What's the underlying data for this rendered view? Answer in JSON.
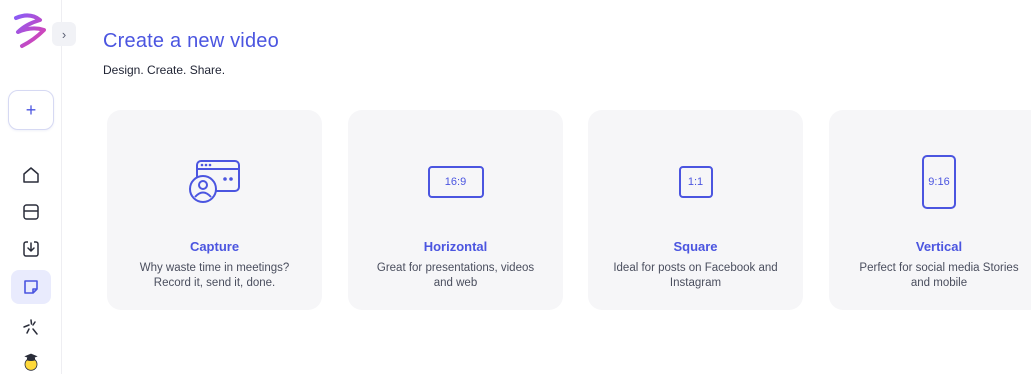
{
  "sidebar": {
    "expand_label": "›",
    "new_label": "+",
    "items": [
      {
        "icon": "home-icon"
      },
      {
        "icon": "layout-icon"
      },
      {
        "icon": "import-icon"
      },
      {
        "icon": "note-icon",
        "active": true
      },
      {
        "icon": "sparkle-icon"
      },
      {
        "icon": "graduation-cap-icon"
      }
    ]
  },
  "header": {
    "title": "Create a new video",
    "subtitle": "Design. Create. Share."
  },
  "cards": [
    {
      "title": "Capture",
      "description": "Why waste time in meetings? Record it, send it, done."
    },
    {
      "title": "Horizontal",
      "description": "Great for presentations, videos and web",
      "ratio": "16:9"
    },
    {
      "title": "Square",
      "description": "Ideal for posts on Facebook and Instagram",
      "ratio": "1:1"
    },
    {
      "title": "Vertical",
      "description": "Perfect for social media Stories and mobile",
      "ratio": "9:16"
    }
  ],
  "colors": {
    "accent": "#4b55e0",
    "card_bg": "#f6f6f8",
    "active_nav": "#e9ebfd"
  }
}
